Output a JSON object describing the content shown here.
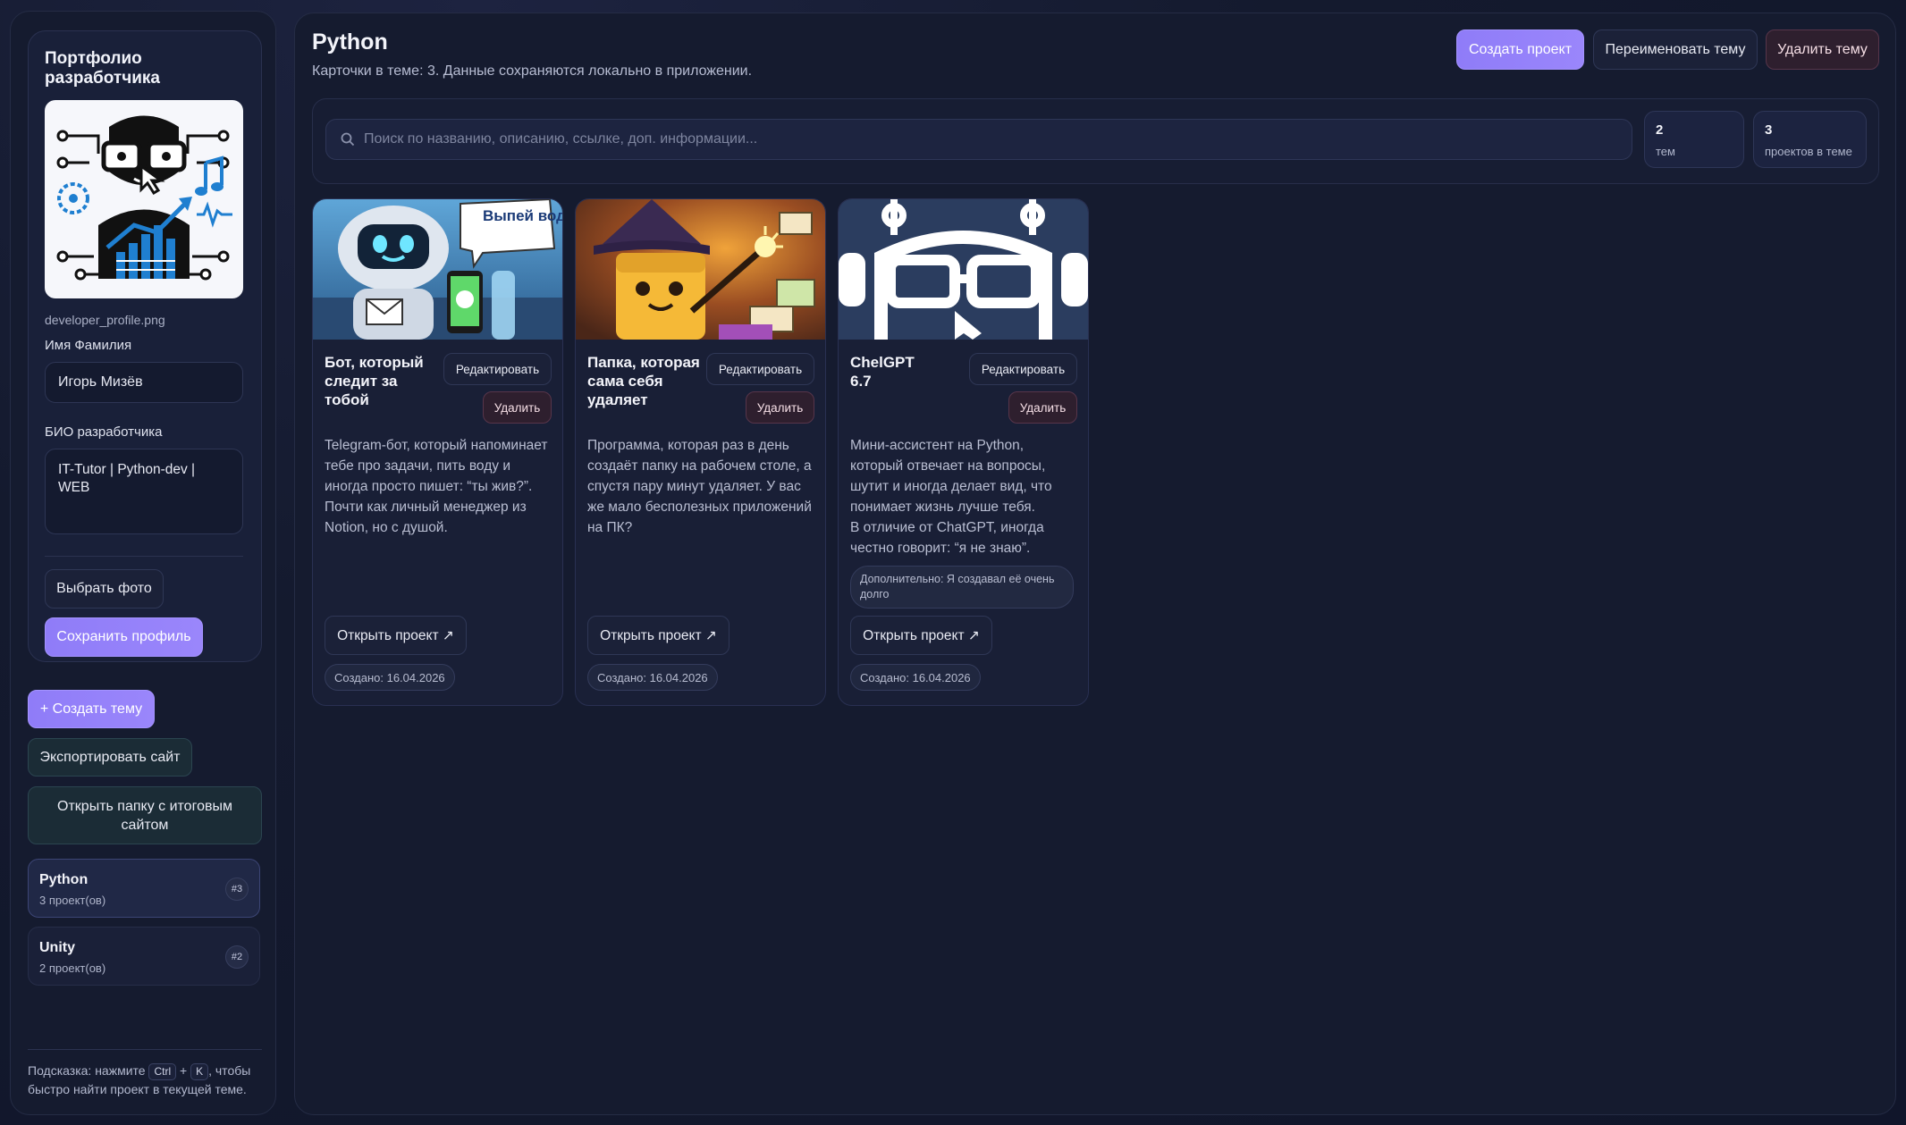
{
  "sidebar": {
    "profile_title": "Портфолио разработчика",
    "avatar_icon": "developer-avatar-illustration",
    "file_name": "developer_profile.png",
    "name_label": "Имя Фамилия",
    "name_value": "Игорь Мизёв",
    "bio_label": "БИО разработчика",
    "bio_value": "IT-Tutor | Python-dev | WEB",
    "choose_photo": "Выбрать фото",
    "save_profile": "Сохранить профиль",
    "create_theme": "+ Создать тему",
    "export_site": "Экспортировать сайт",
    "open_folder": "Открыть папку с итоговым сайтом",
    "themes": [
      {
        "name": "Python",
        "count": "3 проект(ов)",
        "badge": "#3"
      },
      {
        "name": "Unity",
        "count": "2 проект(ов)",
        "badge": "#2"
      }
    ],
    "hint_prefix": "Подсказка: нажмите",
    "hint_key1": "Ctrl",
    "hint_plus": "+",
    "hint_key2": "K",
    "hint_suffix": ", чтобы быстро найти проект в текущей теме."
  },
  "header": {
    "title": "Python",
    "subtitle": "Карточки в теме: 3. Данные сохраняются локально в приложении.",
    "create_project": "Создать проект",
    "rename_theme": "Переименовать тему",
    "delete_theme": "Удалить тему"
  },
  "search": {
    "placeholder": "Поиск по названию, описанию, ссылке, доп. информации..."
  },
  "stats": [
    {
      "num": "2",
      "label": "тем"
    },
    {
      "num": "3",
      "label": "проектов в теме"
    }
  ],
  "cards": [
    {
      "title": "Бот, который следит за тобой",
      "edit": "Редактировать",
      "delete": "Удалить",
      "desc": "Telegram-бот, который напоминает тебе про задачи, пить воду и иногда просто пишет: “ты жив?”. Почти как личный менеджер из Notion, но с душой.",
      "open": "Открыть проект ↗",
      "created": "Создано: 16.04.2026",
      "image_caption": "Выпей воды!"
    },
    {
      "title": "Папка, которая сама себя удаляет",
      "edit": "Редактировать",
      "delete": "Удалить",
      "desc": "Программа, которая раз в день создаёт папку на рабочем столе, а спустя пару минут удаляет. У вас же мало бесполезных приложений на ПК?",
      "open": "Открыть проект ↗",
      "created": "Создано: 16.04.2026"
    },
    {
      "title": "ChelGPT 6.7",
      "edit": "Редактировать",
      "delete": "Удалить",
      "desc_line1": "Мини-ассистент на Python, который отвечает на вопросы, шутит и иногда делает вид, что понимает жизнь лучше тебя.",
      "desc_line2": "В отличие от ChatGPT, иногда честно говорит: “я не знаю”.",
      "extra": "Дополнительно: Я создавал её очень долго",
      "open": "Открыть проект ↗",
      "created": "Создано: 16.04.2026"
    }
  ],
  "colors": {
    "accent": "#8f7cf8",
    "background": "#141a2e",
    "panel": "#151b2f",
    "danger": "#2e1f2e"
  }
}
